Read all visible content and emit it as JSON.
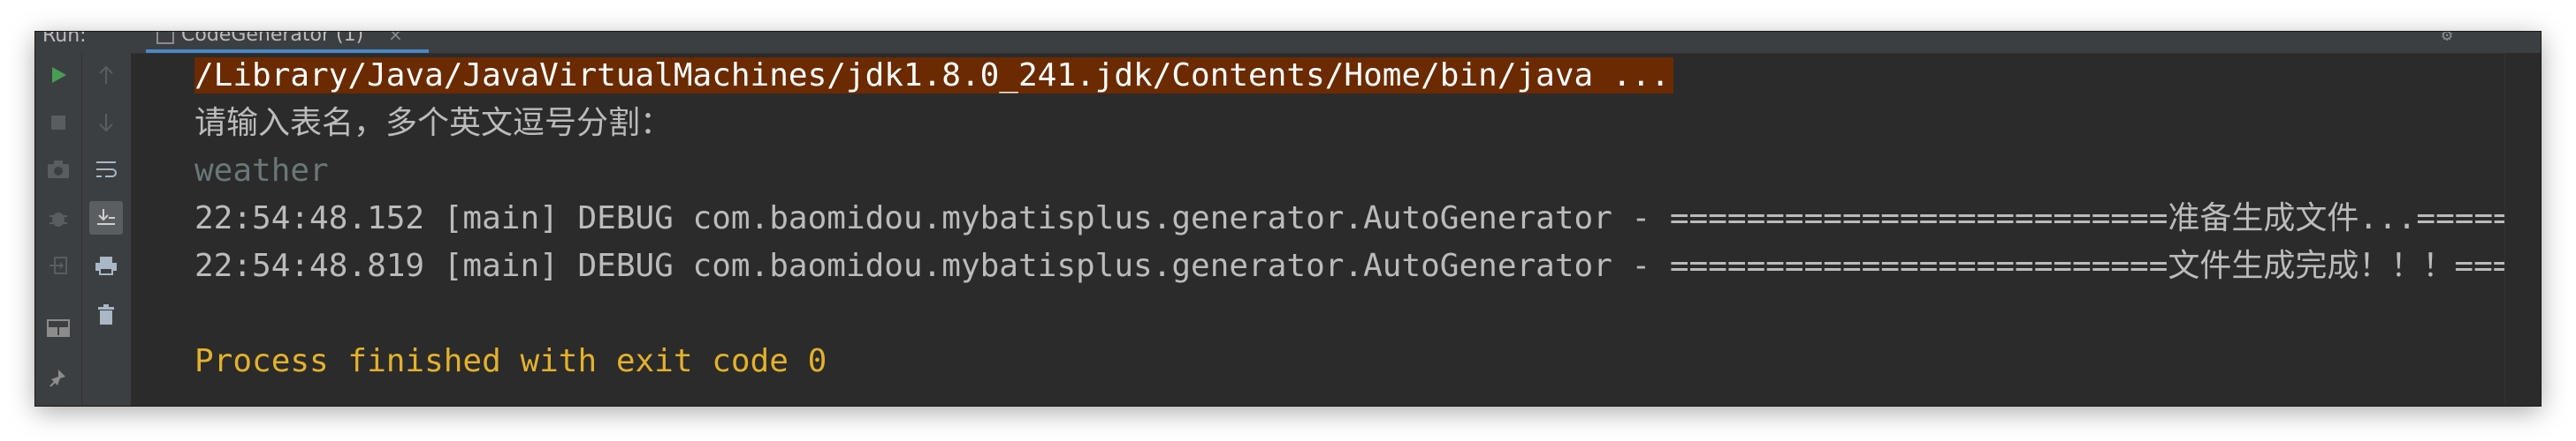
{
  "tool_window": {
    "label": "Run:",
    "tab_label": "CodeGenerator (1)",
    "tab_close": "×"
  },
  "console": {
    "lines": [
      {
        "kind": "command",
        "text": "/Library/Java/JavaVirtualMachines/jdk1.8.0_241.jdk/Contents/Home/bin/java ..."
      },
      {
        "kind": "prompt",
        "text": "请输入表名，多个英文逗号分割："
      },
      {
        "kind": "user-input",
        "text": "weather"
      },
      {
        "kind": "log",
        "text": "22:54:48.152 [main] DEBUG com.baomidou.mybatisplus.generator.AutoGenerator - ==========================准备生成文件...====="
      },
      {
        "kind": "log",
        "text": "22:54:48.819 [main] DEBUG com.baomidou.mybatisplus.generator.AutoGenerator - ==========================文件生成完成！！！==="
      },
      {
        "kind": "blank",
        "text": ""
      },
      {
        "kind": "exit",
        "text": "Process finished with exit code 0"
      }
    ]
  },
  "colors": {
    "background": "#2b2b2b",
    "toolbar": "#3c3f41",
    "command_highlight": "#6b2a00",
    "exit_text": "#e3b12a",
    "run_icon": "#499c54"
  },
  "toolbar_icons": [
    "run-icon",
    "stop-icon",
    "camera-icon",
    "debug-bug-icon",
    "login-icon",
    "layout-icon",
    "pin-icon",
    "up-arrow-icon",
    "down-arrow-icon",
    "soft-wrap-icon",
    "scroll-to-end-icon",
    "print-icon",
    "trash-icon"
  ]
}
